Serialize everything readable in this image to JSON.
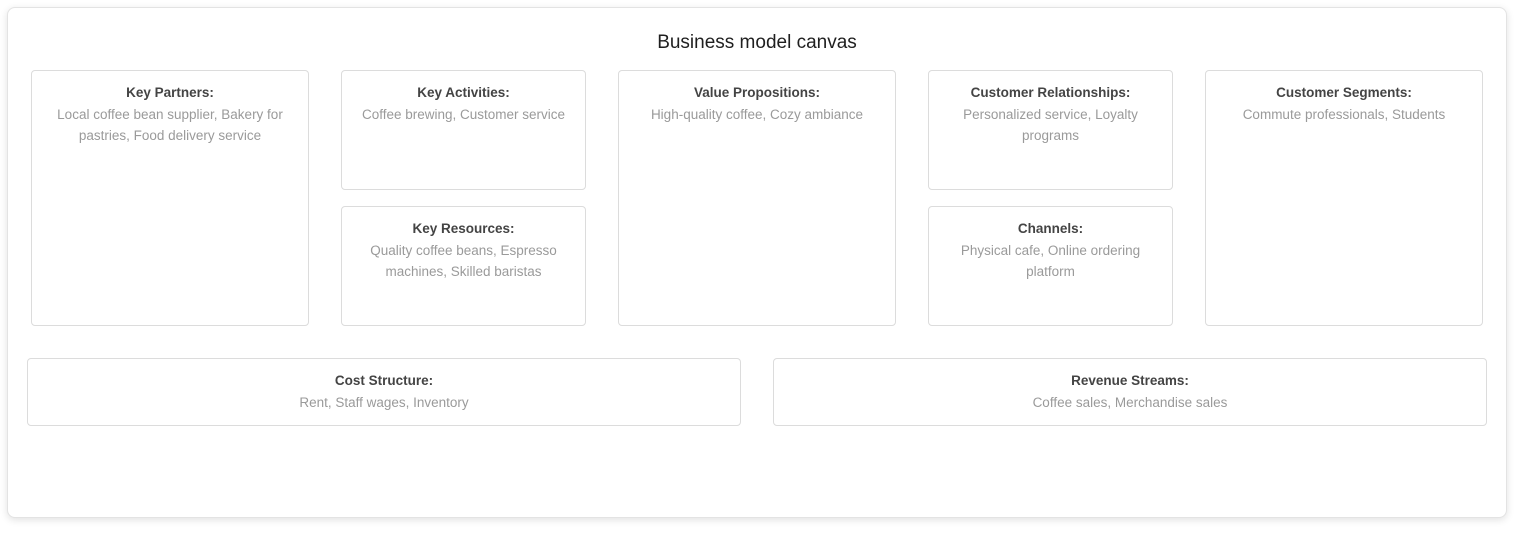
{
  "canvas": {
    "title": "Business model canvas",
    "key_partners": {
      "label": "Key Partners:",
      "content": "Local coffee bean supplier, Bakery for pastries, Food delivery service"
    },
    "key_activities": {
      "label": "Key Activities:",
      "content": "Coffee brewing, Customer service"
    },
    "key_resources": {
      "label": "Key Resources:",
      "content": "Quality coffee beans, Espresso machines, Skilled baristas"
    },
    "value_propositions": {
      "label": "Value Propositions:",
      "content": "High-quality coffee, Cozy ambiance"
    },
    "customer_relationships": {
      "label": "Customer Relationships:",
      "content": "Personalized service, Loyalty programs"
    },
    "channels": {
      "label": "Channels:",
      "content": "Physical cafe, Online ordering platform"
    },
    "customer_segments": {
      "label": "Customer Segments:",
      "content": "Commute professionals, Students"
    },
    "cost_structure": {
      "label": "Cost Structure:",
      "content": "Rent, Staff wages, Inventory"
    },
    "revenue_streams": {
      "label": "Revenue Streams:",
      "content": "Coffee sales, Merchandise sales"
    }
  }
}
